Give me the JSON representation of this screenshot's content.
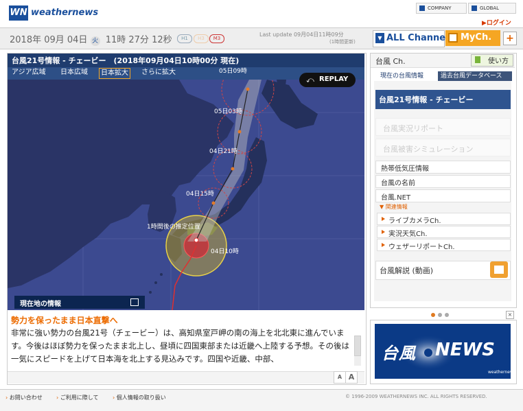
{
  "header": {
    "logo_mark": "WN",
    "logo_text": "weathernews",
    "company_label": "COMPANY",
    "global_label": "GLOBAL",
    "login_label": "▶ログイン"
  },
  "datebar": {
    "date": "2018年 09月 04日",
    "weekday": "火",
    "time": "11時 27分 12秒",
    "badges": [
      "H1",
      "H3",
      "M3"
    ],
    "last_update": "Last update  09月04日11時09分",
    "update_interval": "(1時間更新)",
    "all_channel": "ALL Channel",
    "mych": "MyCh.",
    "plus": "+"
  },
  "panel": {
    "title": "台風21号情報 - チェービー　(2018年09月04日10時00分 現在)",
    "tabs": [
      "アジア広域",
      "日本広域",
      "日本拡大",
      "さらに拡大"
    ],
    "selected_tab": "日本拡大",
    "replay": "REPLAY",
    "map_labels": {
      "t1": "05日09時",
      "t2": "05日03時",
      "t3": "04日21時",
      "t4": "04日15時",
      "est": "1時間後の推定位置",
      "now": "04日10時"
    },
    "current_info": "現在地の情報",
    "headline": "勢力を保ったまま日本直撃へ",
    "body": "非常に強い勢力の台風21号（チェービー）は、高知県室戸岬の南の海上を北北東に進んでいます。今後はほぼ勢力を保ったまま北上し、昼頃に四国東部または近畿へ上陸する予想。その後は一気にスピードを上げて日本海を北上する見込みです。四国や近畿、中部、",
    "text_buttons": [
      "A",
      "A"
    ]
  },
  "sidebar": {
    "title": "台風 Ch.",
    "howto": "使い方",
    "tabs": [
      "現在の台風情報",
      "過去台風データベース"
    ],
    "active_item": "台風21号情報 - チェービー",
    "disabled_items": [
      "台風実況リポート",
      "台風被害シミュレーション"
    ],
    "items": [
      "熱帯低気圧情報",
      "台風の名前",
      "台風.NET"
    ],
    "related_label": "▼ 関連情報",
    "related": [
      "ライブカメラCh.",
      "実況天気Ch.",
      "ウェザーリポートCh."
    ],
    "video": "台風解説 (動画)"
  },
  "ad": {
    "text1": "台風",
    "text2": "NEWS",
    "logo": "weathernews",
    "close": "×"
  },
  "footer": {
    "links": [
      "お問い合わせ",
      "ご利用に際して",
      "個人情報の取り扱い"
    ],
    "copyright": "© 1996-2009 WEATHERNEWS INC. ALL RIGHTS RESERVED."
  },
  "colors": {
    "brand": "#1a4f9c",
    "accent": "#ec6b00",
    "panel_header": "#1f3c6e"
  }
}
